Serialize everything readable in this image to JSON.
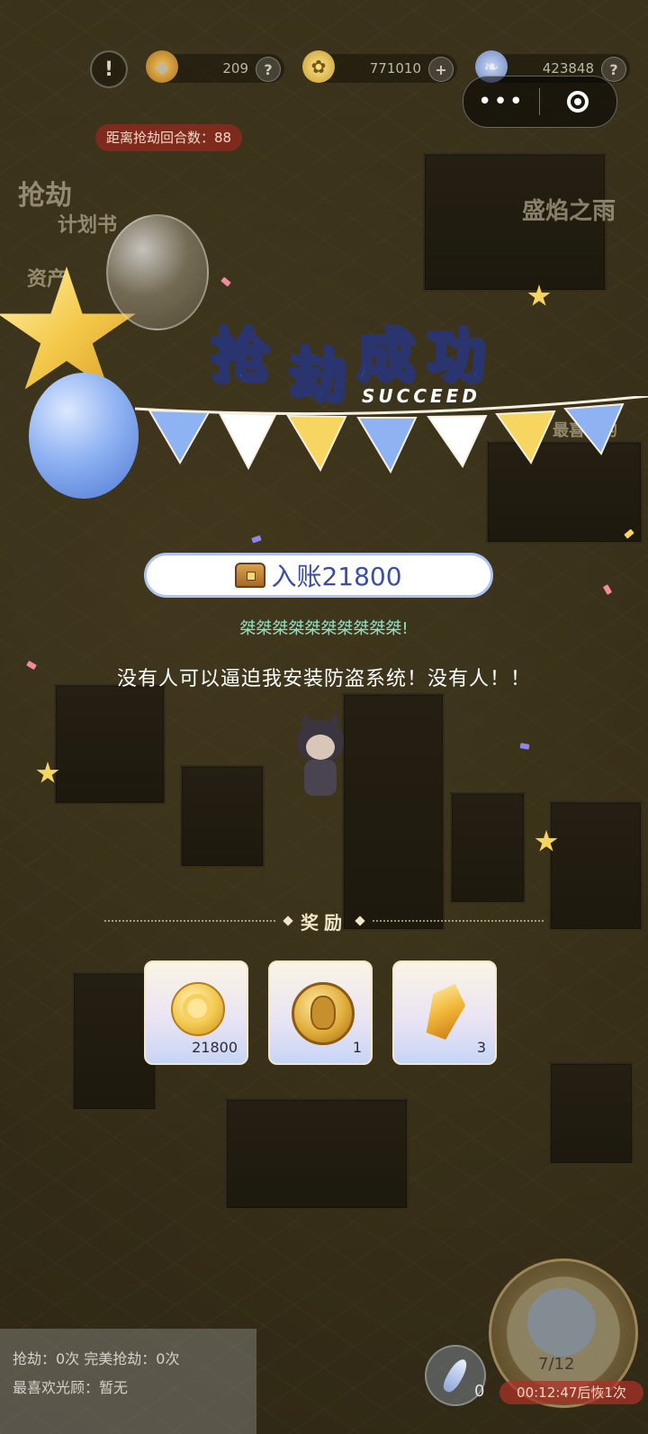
{
  "hud": {
    "alert": "!",
    "resources": [
      {
        "icon": "crystal-icon",
        "value": "209",
        "button": "?"
      },
      {
        "icon": "gold-coin-icon",
        "value": "771010",
        "button": "+"
      },
      {
        "icon": "feather-icon",
        "value": "423848",
        "button": "?"
      }
    ]
  },
  "capsule": {
    "menu": "•••"
  },
  "countdown": "距离抢劫回合数：88",
  "side_labels": {
    "rob_plan": "抢劫",
    "plan": "计划书",
    "assets": "资产",
    "rain": "盛焰之雨",
    "favorite": "最喜欢的"
  },
  "banner": {
    "title_chars": [
      "抢",
      "劫",
      "成",
      "功"
    ],
    "subtitle": "SUCCEED"
  },
  "income": {
    "label": "入账21800"
  },
  "laugh": "桀桀桀桀桀桀桀桀桀桀!",
  "quote": "没有人可以逼迫我安装防盗系统！没有人！！",
  "rewards": {
    "title": "奖励",
    "items": [
      {
        "icon": "gold-coin-icon",
        "count": "21800"
      },
      {
        "icon": "ancient-coin-icon",
        "count": "1"
      },
      {
        "icon": "amber-crystal-icon",
        "count": "3"
      }
    ]
  },
  "bottom": {
    "rob_stats": "抢劫：0次   完美抢劫：0次",
    "favorite": "最喜欢光顾：暂无",
    "feather_count": "0",
    "dial_progress": "7/12",
    "timer": "00:12:47后恢1次"
  },
  "colors": {
    "title_yellow": "#f7e27a",
    "title_blue": "#6f93e6",
    "income_text": "#3a4fa0",
    "laugh_text": "#8fe3c4"
  }
}
